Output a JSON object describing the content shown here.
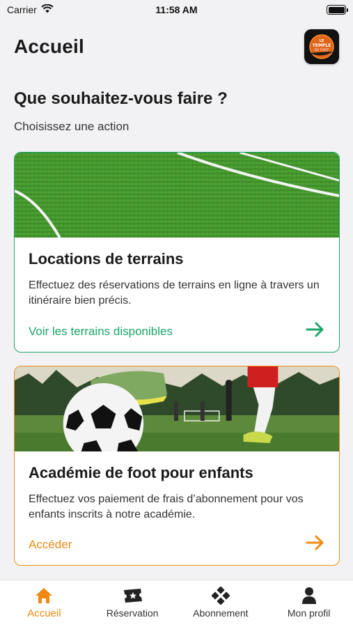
{
  "status_bar": {
    "carrier": "Carrier",
    "time": "11:58 AM",
    "icons": [
      "wifi-icon",
      "battery-icon"
    ]
  },
  "header": {
    "title": "Accueil",
    "logo_text": [
      "LE",
      "TEMPLE",
      "DU FOOT"
    ]
  },
  "intro": {
    "heading": "Que souhaitez-vous faire ?",
    "subheading": "Choisissez une action"
  },
  "cards": [
    {
      "title": "Locations de terrains",
      "description": "Effectuez des réservations de terrains en ligne à travers un itinéraire bien précis.",
      "action_label": "Voir les terrains disponibles",
      "accent": "#1aa568",
      "image": "football-pitch-grass"
    },
    {
      "title": "Académie de foot pour enfants",
      "description": "Effectuez vos paiement de frais d’abonnement pour vos enfants inscrits à notre académie.",
      "action_label": "Accéder",
      "accent": "#f08a14",
      "image": "football-ball-players"
    }
  ],
  "tabs": [
    {
      "label": "Accueil",
      "icon": "home-icon",
      "active": true
    },
    {
      "label": "Réservation",
      "icon": "ticket-icon",
      "active": false
    },
    {
      "label": "Abonnement",
      "icon": "diamond-icon",
      "active": false
    },
    {
      "label": "Mon profil",
      "icon": "user-icon",
      "active": false
    }
  ],
  "colors": {
    "accent_orange": "#f08a14",
    "accent_green": "#1aa568",
    "background": "#f2f2f4"
  }
}
